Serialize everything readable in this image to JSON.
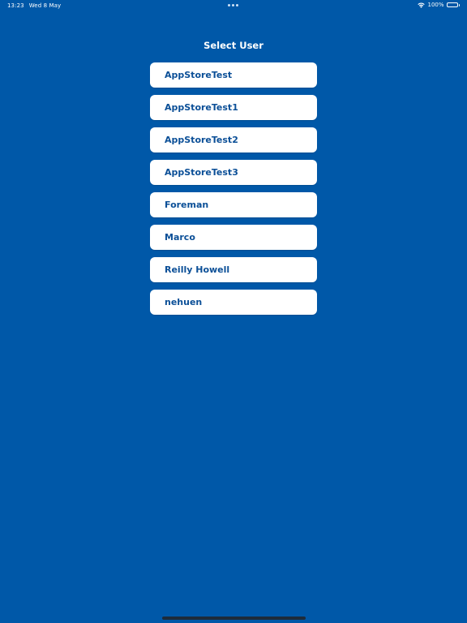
{
  "status_bar": {
    "time": "13:23",
    "date": "Wed 8 May",
    "battery_percent": "100%",
    "battery_level": 1.0,
    "icons": [
      "wifi-icon",
      "battery-icon"
    ]
  },
  "colors": {
    "background": "#0058A8",
    "item_background": "#FFFFFF",
    "item_text": "#0B4F97",
    "title_text": "#FFFFFF"
  },
  "screen": {
    "title": "Select User"
  },
  "users": [
    {
      "label": "AppStoreTest"
    },
    {
      "label": "AppStoreTest1"
    },
    {
      "label": "AppStoreTest2"
    },
    {
      "label": "AppStoreTest3"
    },
    {
      "label": "Foreman"
    },
    {
      "label": "Marco"
    },
    {
      "label": "Reilly Howell"
    },
    {
      "label": "nehuen"
    }
  ]
}
